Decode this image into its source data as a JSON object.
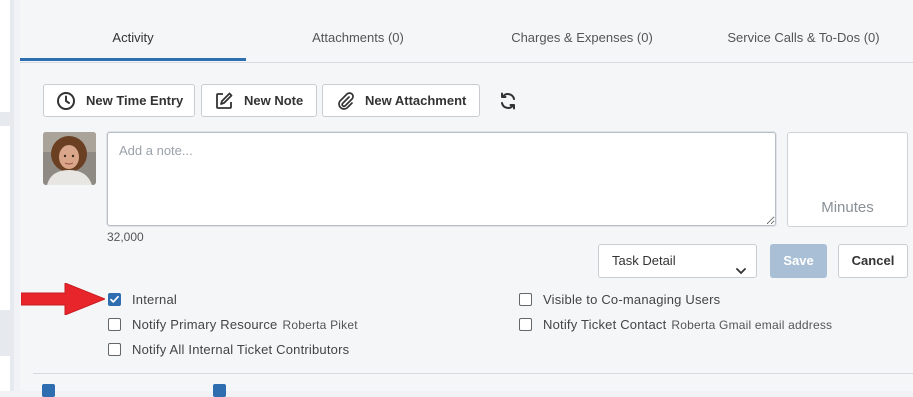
{
  "tabs": [
    {
      "label": "Activity"
    },
    {
      "label": "Attachments (0)"
    },
    {
      "label": "Charges & Expenses (0)"
    },
    {
      "label": "Service Calls & To-Dos (0)"
    }
  ],
  "toolbar": {
    "new_time_entry": "New Time Entry",
    "new_note": "New Note",
    "new_attachment": "New Attachment"
  },
  "note": {
    "placeholder": "Add a note...",
    "counter": "32,000"
  },
  "minutes": {
    "placeholder": "Minutes"
  },
  "select": {
    "selected": "Task Detail"
  },
  "actions": {
    "save": "Save",
    "cancel": "Cancel"
  },
  "options": {
    "internal": {
      "label": "Internal",
      "checked": true
    },
    "notify_primary": {
      "label": "Notify Primary Resource",
      "sub": "Roberta Piket",
      "checked": false
    },
    "notify_all": {
      "label": "Notify All Internal Ticket Contributors",
      "checked": false
    },
    "visible_comanaging": {
      "label": "Visible to Co-managing Users",
      "checked": false
    },
    "notify_contact": {
      "label": "Notify Ticket Contact",
      "sub": "Roberta Gmail email address",
      "checked": false
    }
  },
  "colors": {
    "accent": "#2d6fb0",
    "save_disabled": "#a9bfd6",
    "arrow": "#e8252a"
  }
}
